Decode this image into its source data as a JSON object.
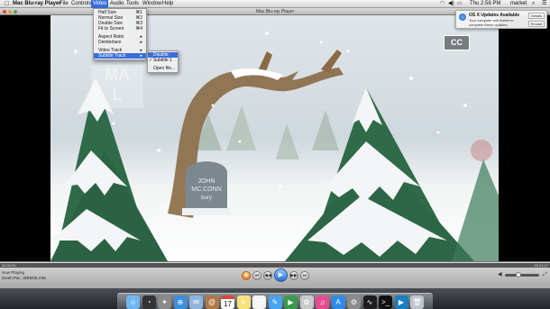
{
  "menubar": {
    "apple_icon": "apple-icon",
    "items": [
      "Mac Blu-ray Player",
      "File",
      "Controls",
      "Video",
      "Audio",
      "Tools",
      "Window",
      "Help"
    ],
    "status": {
      "clock": "Thu 2:58 PM",
      "user": "market"
    }
  },
  "window": {
    "title": "Mac Blu-ray Player"
  },
  "video_menu": {
    "items": [
      {
        "label": "Half Size",
        "shortcut": "⌘1"
      },
      {
        "label": "Normal Size",
        "shortcut": "⌘2"
      },
      {
        "label": "Double Size",
        "shortcut": "⌘3"
      },
      {
        "label": "Fit to Screen",
        "shortcut": "⌘4"
      },
      {
        "label": "Aspect Ratio",
        "shortcut": "▸"
      },
      {
        "label": "Deinterlace",
        "shortcut": "▸"
      },
      {
        "label": "Video Track",
        "shortcut": "▸"
      },
      {
        "label": "Subtitle Track",
        "shortcut": "▸"
      }
    ]
  },
  "subtitle_menu": {
    "items": [
      {
        "label": "Disable",
        "checked": false
      },
      {
        "label": "Subtitle 1",
        "checked": true
      },
      {
        "label": "Open file...",
        "checked": false
      }
    ]
  },
  "notification": {
    "title": "OS X Updates Available",
    "body": "Your computer will restart to complete these updates.",
    "details_label": "Details",
    "restart_label": "Restart"
  },
  "video": {
    "cc_badge": "CC",
    "tombstone_text": "JOHN\nMC.CONN\nbury",
    "watermark_top": "MA",
    "watermark_bottom": "L"
  },
  "player": {
    "time_elapsed": "00:00:00",
    "time_total": "00:21:47",
    "progress_fraction": 0.0,
    "now_playing_label": "Now Playing",
    "now_playing_file": "South.Par...WEBSE.mkv",
    "volume_fraction": 0.4
  },
  "dock": {
    "icons": [
      "finder-icon",
      "dashboard-icon",
      "launchpad-icon",
      "safari-icon",
      "mail-icon",
      "contacts-icon",
      "calendar-icon",
      "notes-icon",
      "reminders-icon",
      "messages-icon",
      "facetime-icon",
      "photos-icon",
      "itunes-icon",
      "app-store-icon",
      "system-preferences-icon",
      "activity-monitor-icon",
      "terminal-icon",
      "blu-ray-player-icon",
      "trash-icon"
    ],
    "calendar_day": "17"
  },
  "colors": {
    "menu_highlight": "#3a6fd8",
    "tree_green": "#2f6b49",
    "branch_brown": "#8a6a45"
  }
}
